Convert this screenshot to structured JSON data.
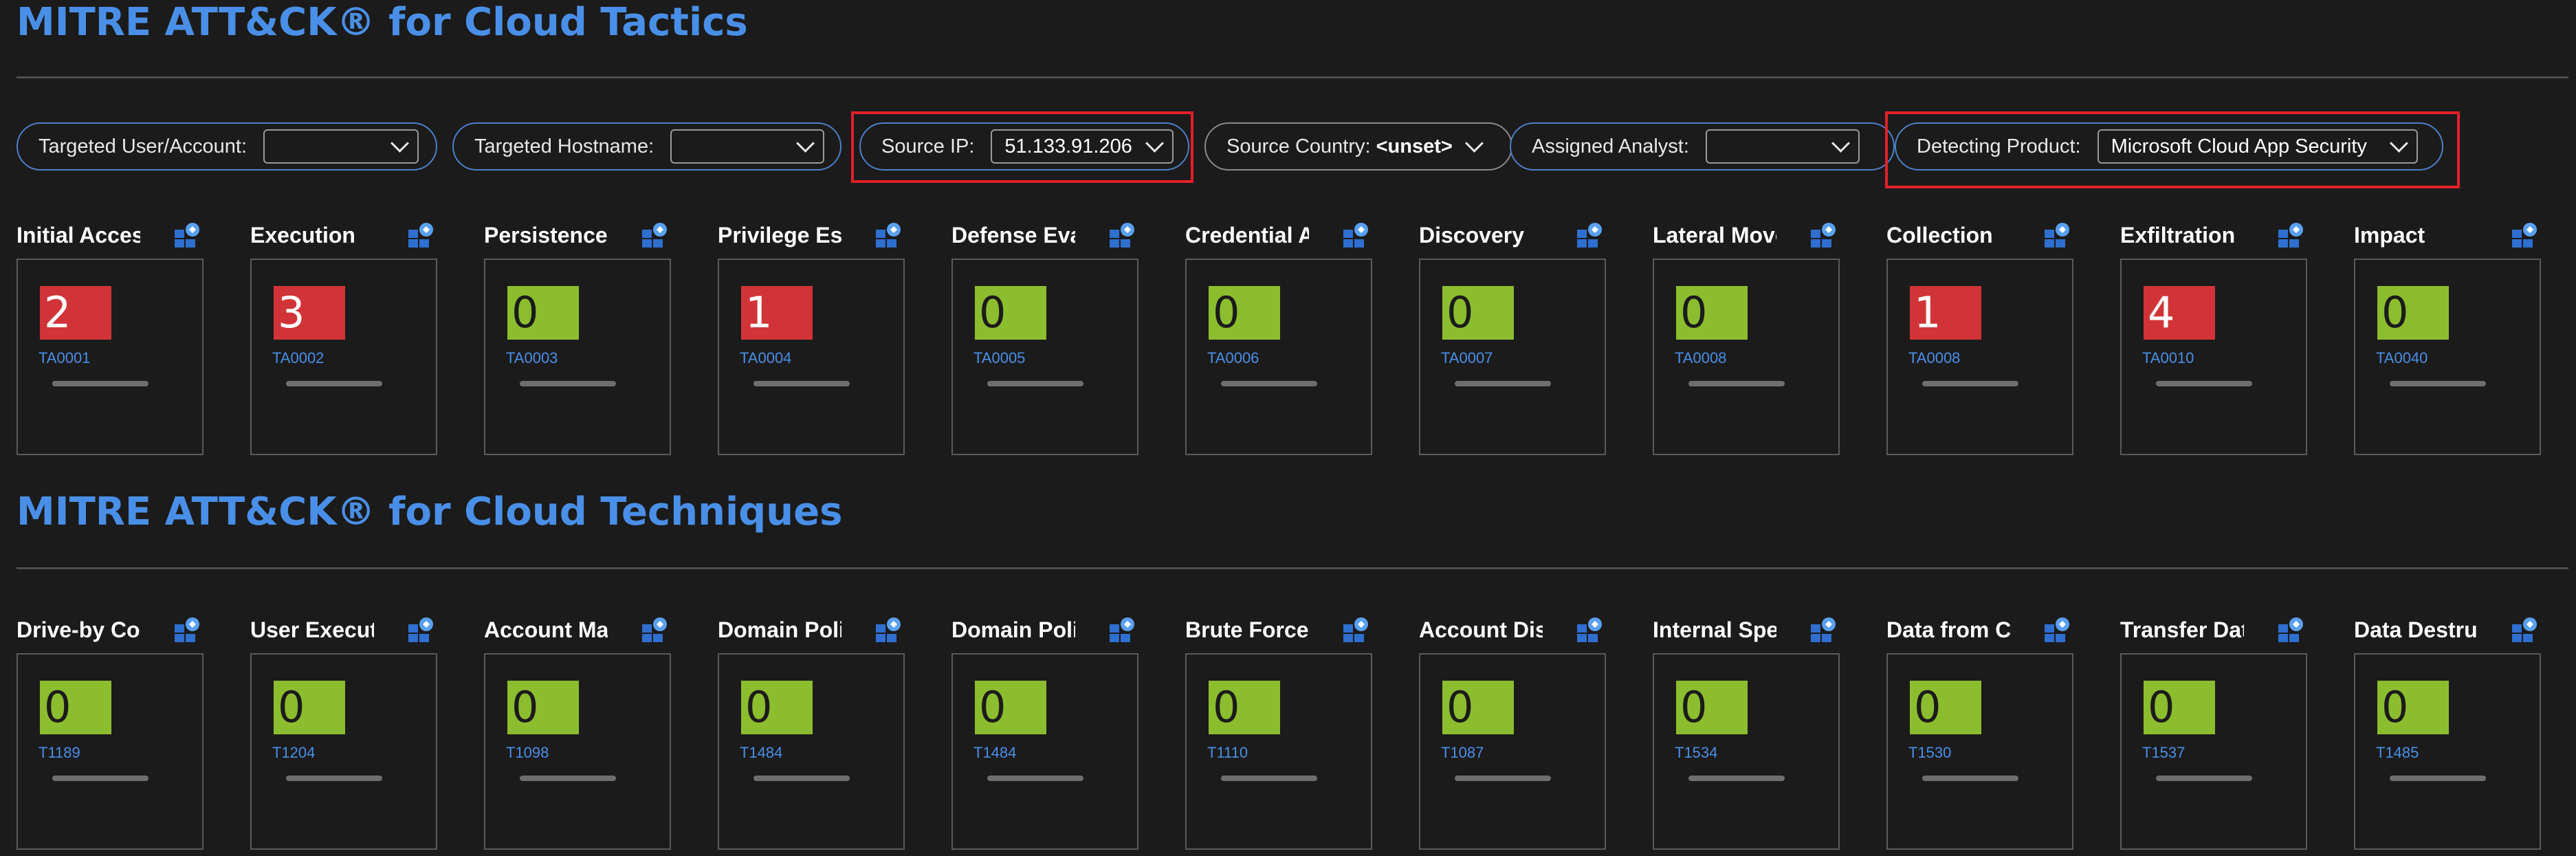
{
  "tactics_section": {
    "title": "MITRE ATT&CK® for Cloud Tactics"
  },
  "techniques_section": {
    "title": "MITRE ATT&CK® for Cloud Techniques"
  },
  "filters": {
    "targeted_user": {
      "label": "Targeted User/Account:",
      "value": ""
    },
    "targeted_hostname": {
      "label": "Targeted Hostname:",
      "value": ""
    },
    "source_ip": {
      "label": "Source IP:",
      "value": "51.133.91.206"
    },
    "source_country": {
      "label": "Source Country:",
      "value": "<unset>"
    },
    "assigned_analyst": {
      "label": "Assigned Analyst:",
      "value": ""
    },
    "detecting_product": {
      "label": "Detecting Product:",
      "value": "Microsoft Cloud App Security"
    }
  },
  "tactics": [
    {
      "title": "Initial Access",
      "count": "2",
      "code": "TA0001",
      "status": "alert"
    },
    {
      "title": "Execution",
      "count": "3",
      "code": "TA0002",
      "status": "alert"
    },
    {
      "title": "Persistence",
      "count": "0",
      "code": "TA0003",
      "status": "ok"
    },
    {
      "title": "Privilege Escalation",
      "count": "1",
      "code": "TA0004",
      "status": "alert"
    },
    {
      "title": "Defense Evasion",
      "count": "0",
      "code": "TA0005",
      "status": "ok"
    },
    {
      "title": "Credential Access",
      "count": "0",
      "code": "TA0006",
      "status": "ok"
    },
    {
      "title": "Discovery",
      "count": "0",
      "code": "TA0007",
      "status": "ok"
    },
    {
      "title": "Lateral Movement",
      "count": "0",
      "code": "TA0008",
      "status": "ok"
    },
    {
      "title": "Collection",
      "count": "1",
      "code": "TA0008",
      "status": "alert"
    },
    {
      "title": "Exfiltration",
      "count": "4",
      "code": "TA0010",
      "status": "alert"
    },
    {
      "title": "Impact",
      "count": "0",
      "code": "TA0040",
      "status": "ok"
    }
  ],
  "techniques": [
    {
      "title": "Drive-by Compromise",
      "count": "0",
      "code": "T1189",
      "status": "ok"
    },
    {
      "title": "User Execution",
      "count": "0",
      "code": "T1204",
      "status": "ok"
    },
    {
      "title": "Account Manipulation",
      "count": "0",
      "code": "T1098",
      "status": "ok"
    },
    {
      "title": "Domain Policy Modification",
      "count": "0",
      "code": "T1484",
      "status": "ok"
    },
    {
      "title": "Domain Policy Modification",
      "count": "0",
      "code": "T1484",
      "status": "ok"
    },
    {
      "title": "Brute Force",
      "count": "0",
      "code": "T1110",
      "status": "ok"
    },
    {
      "title": "Account Discovery",
      "count": "0",
      "code": "T1087",
      "status": "ok"
    },
    {
      "title": "Internal Spearphishing",
      "count": "0",
      "code": "T1534",
      "status": "ok"
    },
    {
      "title": "Data from Cloud Storage",
      "count": "0",
      "code": "T1530",
      "status": "ok"
    },
    {
      "title": "Transfer Data to Cloud Account",
      "count": "0",
      "code": "T1537",
      "status": "ok"
    },
    {
      "title": "Data Destruction",
      "count": "0",
      "code": "T1485",
      "status": "ok"
    }
  ],
  "colors": {
    "accent": "#4a8fe7",
    "alert": "#d13438",
    "ok": "#8cbd2f",
    "highlight": "#e3202b"
  },
  "icons": {
    "tile_icon": "workbook-link-icon",
    "dropdown": "chevron-down-icon"
  }
}
